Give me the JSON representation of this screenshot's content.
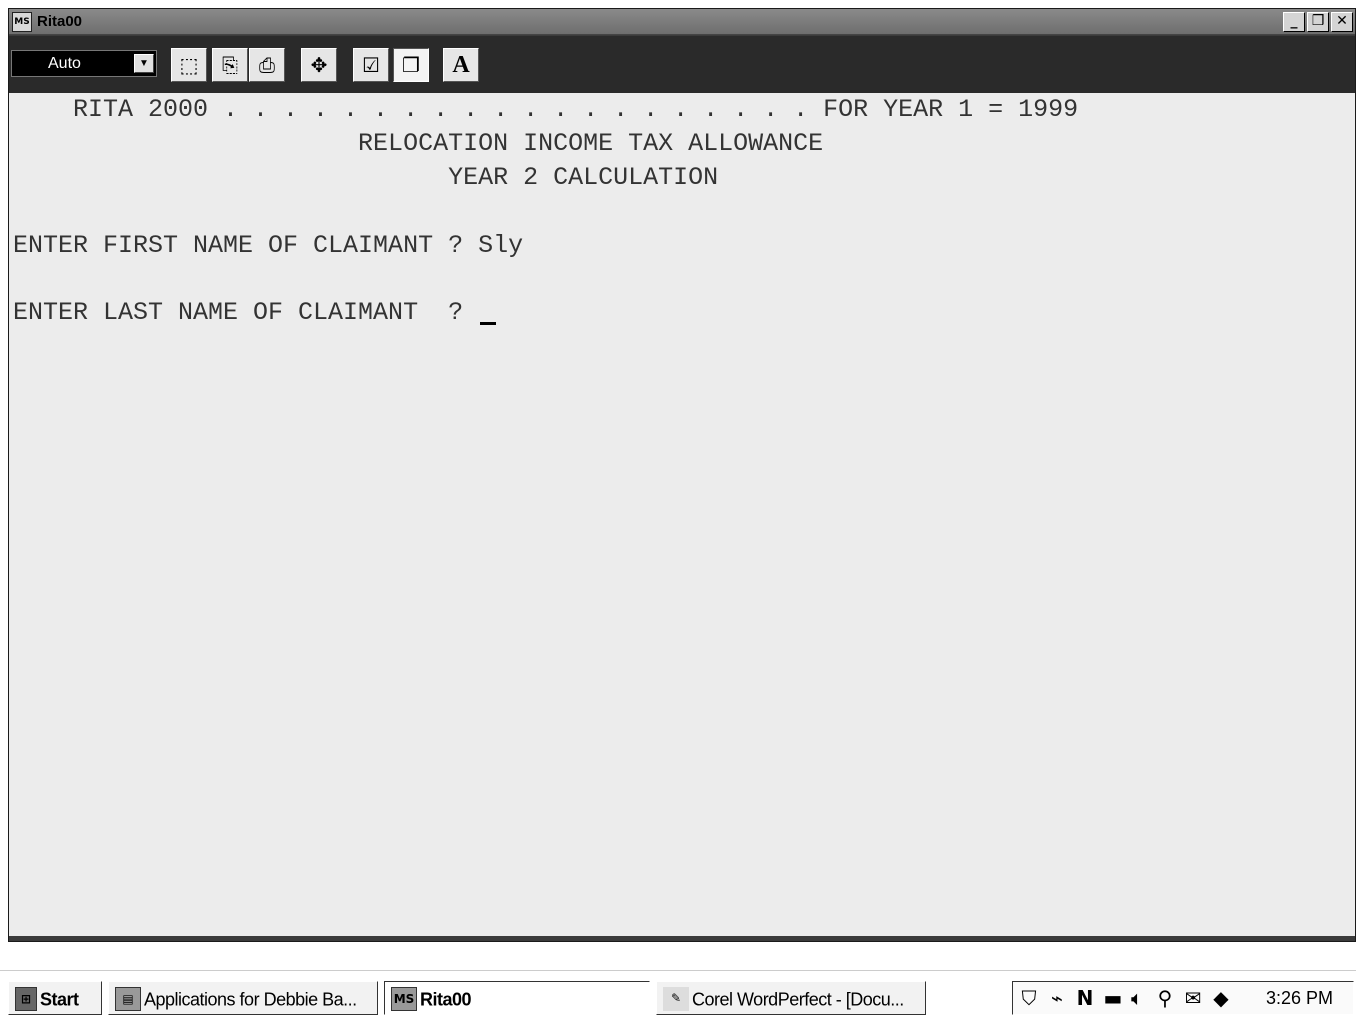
{
  "window": {
    "title": "Rita00",
    "icon": "app-icon",
    "controls": {
      "minimize": "_",
      "restore": "❒",
      "close": "✕"
    }
  },
  "toolbar": {
    "font_size_value": "Auto",
    "buttons": [
      {
        "name": "mark",
        "glyph": "⬚"
      },
      {
        "name": "copy",
        "glyph": "⎘"
      },
      {
        "name": "paste",
        "glyph": "⎙"
      },
      {
        "name": "full-screen",
        "glyph": "✥"
      },
      {
        "name": "properties",
        "glyph": "☑"
      },
      {
        "name": "background",
        "glyph": "❐"
      },
      {
        "name": "font",
        "glyph": "A"
      }
    ]
  },
  "terminal": {
    "line1": "    RITA 2000 . . . . . . . . . . . . . . . . . . . . FOR YEAR 1 = 1999",
    "line2": "                       RELOCATION INCOME TAX ALLOWANCE",
    "line3": "                             YEAR 2 CALCULATION",
    "line4": "ENTER FIRST NAME OF CLAIMANT ? Sly",
    "line5": "ENTER LAST NAME OF CLAIMANT  ? "
  },
  "taskbar": {
    "start_label": "Start",
    "tasks": [
      {
        "label": "Applications for Debbie Ba..."
      },
      {
        "label": "Rita00"
      },
      {
        "label": "Corel WordPerfect - [Docu..."
      }
    ],
    "clock": "3:26 PM"
  }
}
